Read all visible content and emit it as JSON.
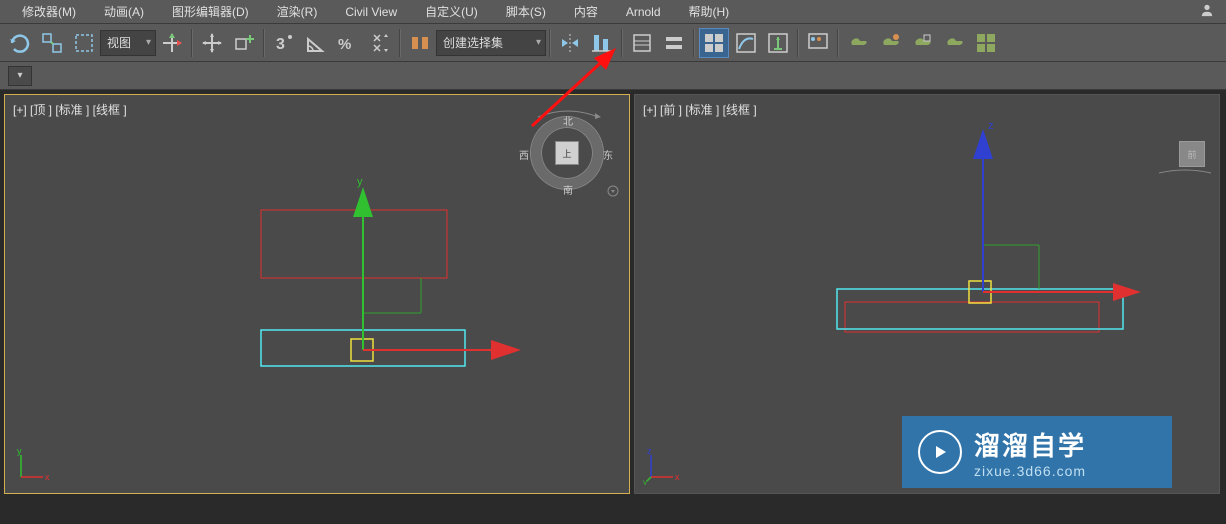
{
  "menubar": {
    "items": [
      "修改器(M)",
      "动画(A)",
      "图形编辑器(D)",
      "渲染(R)",
      "Civil View",
      "自定义(U)",
      "脚本(S)",
      "内容",
      "Arnold",
      "帮助(H)"
    ]
  },
  "toolbar": {
    "view_dropdown": "视图",
    "selset_dropdown": "创建选择集"
  },
  "viewport_left": {
    "label": "[+] [顶 ] [标准 ] [线框 ]"
  },
  "viewport_right": {
    "label": "[+] [前 ] [标准 ] [线框 ]"
  },
  "viewcube": {
    "face": "上",
    "north": "北",
    "south": "南",
    "east": "东",
    "west": "西"
  },
  "mini_cube": "前",
  "watermark": {
    "title": "溜溜自学",
    "url": "zixue.3d66.com"
  }
}
